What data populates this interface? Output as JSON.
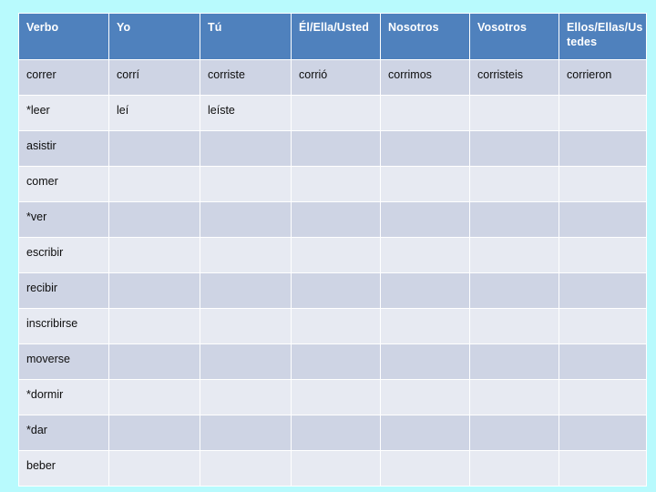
{
  "slide": {
    "background_color": "#b8fafd",
    "header_color": "#4f81bd",
    "band_dark_color": "#ced4e4",
    "band_light_color": "#e7eaf2"
  },
  "table": {
    "headers": [
      "Verbo",
      "Yo",
      "Tú",
      "Él/Ella/Usted",
      "Nosotros",
      "Vosotros",
      "Ellos/Ellas/Ustedes"
    ],
    "rows": [
      {
        "band": "dark",
        "cells": [
          "correr",
          "corrí",
          "corriste",
          "corrió",
          "corrimos",
          "corristeis",
          "corrieron"
        ]
      },
      {
        "band": "light",
        "cells": [
          "*leer",
          "leí",
          "leíste",
          "",
          "",
          "",
          ""
        ]
      },
      {
        "band": "dark",
        "cells": [
          "asistir",
          "",
          "",
          "",
          "",
          "",
          ""
        ]
      },
      {
        "band": "light",
        "cells": [
          "comer",
          "",
          "",
          "",
          "",
          "",
          ""
        ]
      },
      {
        "band": "dark",
        "cells": [
          "*ver",
          "",
          "",
          "",
          "",
          "",
          ""
        ]
      },
      {
        "band": "light",
        "cells": [
          "escribir",
          "",
          "",
          "",
          "",
          "",
          ""
        ]
      },
      {
        "band": "dark",
        "cells": [
          "recibir",
          "",
          "",
          "",
          "",
          "",
          ""
        ]
      },
      {
        "band": "light",
        "cells": [
          "inscribirse",
          "",
          "",
          "",
          "",
          "",
          ""
        ]
      },
      {
        "band": "dark",
        "cells": [
          "moverse",
          "",
          "",
          "",
          "",
          "",
          ""
        ]
      },
      {
        "band": "light",
        "cells": [
          "*dormir",
          "",
          "",
          "",
          "",
          "",
          ""
        ]
      },
      {
        "band": "dark",
        "cells": [
          "*dar",
          "",
          "",
          "",
          "",
          "",
          ""
        ]
      },
      {
        "band": "light",
        "cells": [
          "beber",
          "",
          "",
          "",
          "",
          "",
          ""
        ]
      }
    ]
  }
}
